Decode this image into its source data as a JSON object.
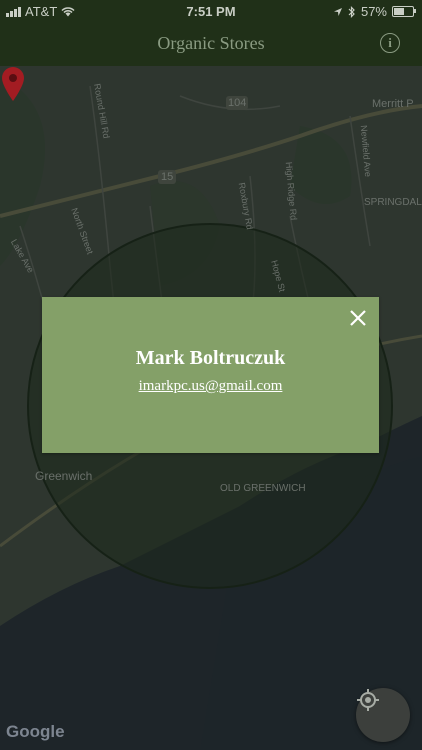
{
  "status_bar": {
    "carrier": "AT&T",
    "time": "7:51 PM",
    "battery": "57%",
    "battery_level": 0.57,
    "icons": [
      "signal-icon",
      "wifi-icon",
      "location-arrow-icon",
      "bluetooth-icon",
      "battery-icon"
    ]
  },
  "nav_bar": {
    "title": "Organic Stores",
    "info_icon": "info-icon",
    "info_glyph": "i"
  },
  "map": {
    "labels": {
      "merritt": "Merritt P",
      "springdale": "SPRINGDALE",
      "greenwich": "Greenwich",
      "old_greenwich": "OLD GREENWICH",
      "north_street": "North Street",
      "round_hill": "Round Hill Rd",
      "lake_ave": "Lake Ave",
      "roxbury": "Roxbury Rd",
      "high_ridge": "High Ridge Rd",
      "hope_st": "Hope St",
      "newfield": "Newfield Ave",
      "route_104": "104",
      "route_15": "15"
    },
    "attribution": "Google",
    "pin_icon": "map-pin-icon",
    "locate_icon": "my-location-icon"
  },
  "store_popup": {
    "name": "Mark Boltruczuk",
    "email": "imarkpc.us@gmail.com",
    "close_icon": "close-icon"
  },
  "colors": {
    "nav_bg": "#203018",
    "popup_bg": "#84a068",
    "pin": "#c8202a"
  }
}
